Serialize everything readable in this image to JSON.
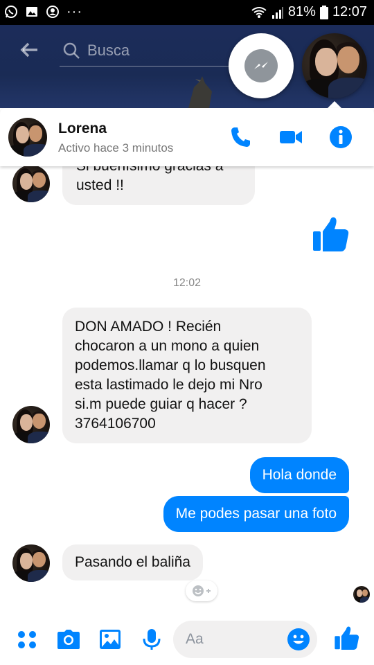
{
  "status_bar": {
    "battery": "81%",
    "time": "12:07",
    "overflow": "···"
  },
  "top": {
    "search_placeholder": "Busca"
  },
  "contact": {
    "name": "Lorena",
    "status": "Activo hace 3 minutos"
  },
  "messages": [
    {
      "from": "them",
      "text_line1": "Si buenísimo gracias a",
      "text_line2": "usted !!"
    },
    {
      "from": "me",
      "type": "like"
    },
    {
      "type": "timestamp",
      "text": "12:02"
    },
    {
      "from": "them",
      "lines": [
        "DON AMADO  ! Recién",
        "chocaron a un mono a quien",
        "podemos.llamar q lo busquen",
        "esta lastimado le dejo mi Nro",
        "si.m puede guiar q hacer ?",
        "3764106700"
      ]
    },
    {
      "from": "me",
      "text": "Hola donde"
    },
    {
      "from": "me",
      "text": "Me  podes pasar una foto"
    },
    {
      "from": "them",
      "text": "Pasando el baliña"
    }
  ],
  "composer": {
    "placeholder": "Aa"
  },
  "colors": {
    "accent": "#0084ff",
    "incoming_bubble": "#f1f0f0",
    "header_bg": "#1c2c5a"
  },
  "icons": [
    "whatsapp-icon",
    "gallery-icon",
    "account-icon",
    "wifi-icon",
    "signal-icon",
    "battery-icon",
    "back-arrow-icon",
    "search-icon",
    "messenger-icon",
    "phone-icon",
    "video-icon",
    "info-icon",
    "like-icon",
    "add-reaction-icon",
    "more-apps-icon",
    "camera-icon",
    "image-icon",
    "mic-icon",
    "emoji-icon"
  ]
}
